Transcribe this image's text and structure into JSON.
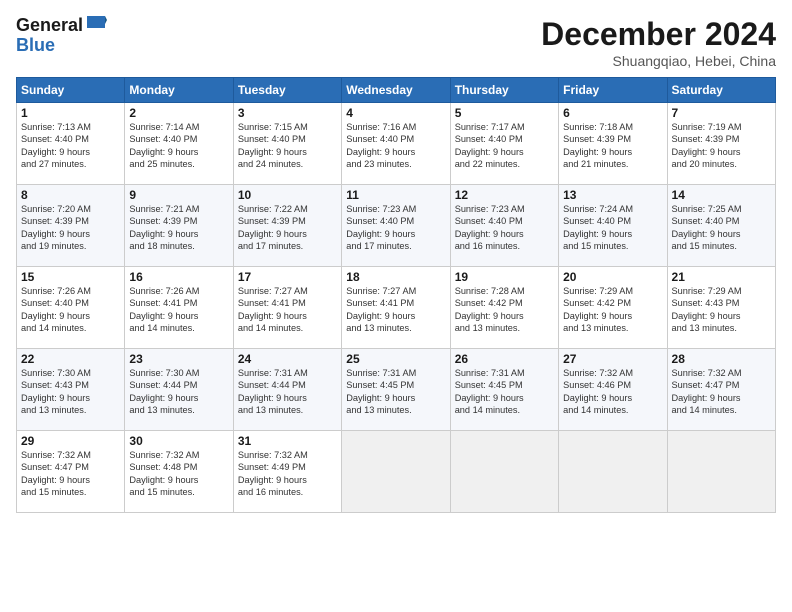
{
  "header": {
    "logo_line1": "General",
    "logo_line2": "Blue",
    "month_title": "December 2024",
    "subtitle": "Shuangqiao, Hebei, China"
  },
  "days_of_week": [
    "Sunday",
    "Monday",
    "Tuesday",
    "Wednesday",
    "Thursday",
    "Friday",
    "Saturday"
  ],
  "weeks": [
    [
      {
        "day": "1",
        "sunrise": "7:13 AM",
        "sunset": "4:40 PM",
        "daylight_h": "9",
        "daylight_m": "27"
      },
      {
        "day": "2",
        "sunrise": "7:14 AM",
        "sunset": "4:40 PM",
        "daylight_h": "9",
        "daylight_m": "25"
      },
      {
        "day": "3",
        "sunrise": "7:15 AM",
        "sunset": "4:40 PM",
        "daylight_h": "9",
        "daylight_m": "24"
      },
      {
        "day": "4",
        "sunrise": "7:16 AM",
        "sunset": "4:40 PM",
        "daylight_h": "9",
        "daylight_m": "23"
      },
      {
        "day": "5",
        "sunrise": "7:17 AM",
        "sunset": "4:40 PM",
        "daylight_h": "9",
        "daylight_m": "22"
      },
      {
        "day": "6",
        "sunrise": "7:18 AM",
        "sunset": "4:39 PM",
        "daylight_h": "9",
        "daylight_m": "21"
      },
      {
        "day": "7",
        "sunrise": "7:19 AM",
        "sunset": "4:39 PM",
        "daylight_h": "9",
        "daylight_m": "20"
      }
    ],
    [
      {
        "day": "8",
        "sunrise": "7:20 AM",
        "sunset": "4:39 PM",
        "daylight_h": "9",
        "daylight_m": "19"
      },
      {
        "day": "9",
        "sunrise": "7:21 AM",
        "sunset": "4:39 PM",
        "daylight_h": "9",
        "daylight_m": "18"
      },
      {
        "day": "10",
        "sunrise": "7:22 AM",
        "sunset": "4:39 PM",
        "daylight_h": "9",
        "daylight_m": "17"
      },
      {
        "day": "11",
        "sunrise": "7:23 AM",
        "sunset": "4:40 PM",
        "daylight_h": "9",
        "daylight_m": "17"
      },
      {
        "day": "12",
        "sunrise": "7:23 AM",
        "sunset": "4:40 PM",
        "daylight_h": "9",
        "daylight_m": "16"
      },
      {
        "day": "13",
        "sunrise": "7:24 AM",
        "sunset": "4:40 PM",
        "daylight_h": "9",
        "daylight_m": "15"
      },
      {
        "day": "14",
        "sunrise": "7:25 AM",
        "sunset": "4:40 PM",
        "daylight_h": "9",
        "daylight_m": "15"
      }
    ],
    [
      {
        "day": "15",
        "sunrise": "7:26 AM",
        "sunset": "4:40 PM",
        "daylight_h": "9",
        "daylight_m": "14"
      },
      {
        "day": "16",
        "sunrise": "7:26 AM",
        "sunset": "4:41 PM",
        "daylight_h": "9",
        "daylight_m": "14"
      },
      {
        "day": "17",
        "sunrise": "7:27 AM",
        "sunset": "4:41 PM",
        "daylight_h": "9",
        "daylight_m": "14"
      },
      {
        "day": "18",
        "sunrise": "7:27 AM",
        "sunset": "4:41 PM",
        "daylight_h": "9",
        "daylight_m": "13"
      },
      {
        "day": "19",
        "sunrise": "7:28 AM",
        "sunset": "4:42 PM",
        "daylight_h": "9",
        "daylight_m": "13"
      },
      {
        "day": "20",
        "sunrise": "7:29 AM",
        "sunset": "4:42 PM",
        "daylight_h": "9",
        "daylight_m": "13"
      },
      {
        "day": "21",
        "sunrise": "7:29 AM",
        "sunset": "4:43 PM",
        "daylight_h": "9",
        "daylight_m": "13"
      }
    ],
    [
      {
        "day": "22",
        "sunrise": "7:30 AM",
        "sunset": "4:43 PM",
        "daylight_h": "9",
        "daylight_m": "13"
      },
      {
        "day": "23",
        "sunrise": "7:30 AM",
        "sunset": "4:44 PM",
        "daylight_h": "9",
        "daylight_m": "13"
      },
      {
        "day": "24",
        "sunrise": "7:31 AM",
        "sunset": "4:44 PM",
        "daylight_h": "9",
        "daylight_m": "13"
      },
      {
        "day": "25",
        "sunrise": "7:31 AM",
        "sunset": "4:45 PM",
        "daylight_h": "9",
        "daylight_m": "13"
      },
      {
        "day": "26",
        "sunrise": "7:31 AM",
        "sunset": "4:45 PM",
        "daylight_h": "9",
        "daylight_m": "14"
      },
      {
        "day": "27",
        "sunrise": "7:32 AM",
        "sunset": "4:46 PM",
        "daylight_h": "9",
        "daylight_m": "14"
      },
      {
        "day": "28",
        "sunrise": "7:32 AM",
        "sunset": "4:47 PM",
        "daylight_h": "9",
        "daylight_m": "14"
      }
    ],
    [
      {
        "day": "29",
        "sunrise": "7:32 AM",
        "sunset": "4:47 PM",
        "daylight_h": "9",
        "daylight_m": "15"
      },
      {
        "day": "30",
        "sunrise": "7:32 AM",
        "sunset": "4:48 PM",
        "daylight_h": "9",
        "daylight_m": "15"
      },
      {
        "day": "31",
        "sunrise": "7:32 AM",
        "sunset": "4:49 PM",
        "daylight_h": "9",
        "daylight_m": "16"
      },
      null,
      null,
      null,
      null
    ]
  ]
}
